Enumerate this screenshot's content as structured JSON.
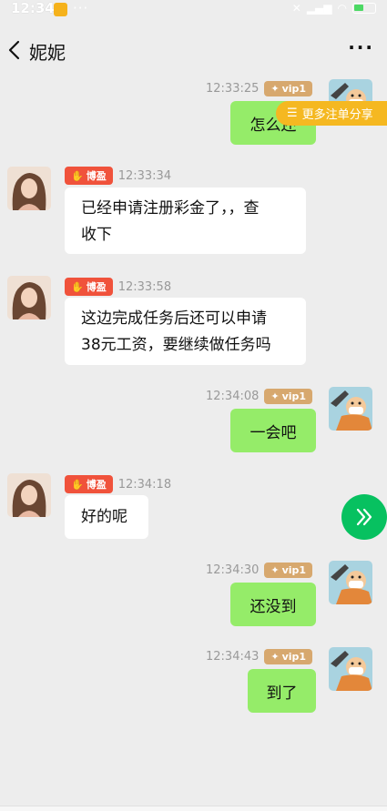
{
  "status": {
    "time": "12:34",
    "dots": "···",
    "battery": "37"
  },
  "header": {
    "title": "妮妮",
    "more": "···"
  },
  "vip_label": "vip1",
  "boying_label": "博盈",
  "share_label": "更多注单分享",
  "messages": [
    {
      "side": "right",
      "time": "12:33:25",
      "text": "怎么还"
    },
    {
      "side": "left",
      "time": "12:33:34",
      "line1": "已经申请注册彩金了，，查",
      "line2": "收下"
    },
    {
      "side": "left",
      "time": "12:33:58",
      "line1": "这边完成任务后还可以申请",
      "line2": "38元工资，要继续做任务吗"
    },
    {
      "side": "right",
      "time": "12:34:08",
      "text": "一会吧"
    },
    {
      "side": "left",
      "time": "12:34:18",
      "text": "好的呢"
    },
    {
      "side": "right",
      "time": "12:34:30",
      "text": "还没到"
    },
    {
      "side": "right",
      "time": "12:34:43",
      "text": "到了"
    }
  ],
  "colors": {
    "green_bubble": "#95ec69",
    "vip": "#d7a86e",
    "boying": "#f0523b",
    "share": "#f5b821",
    "fab": "#07c160"
  }
}
